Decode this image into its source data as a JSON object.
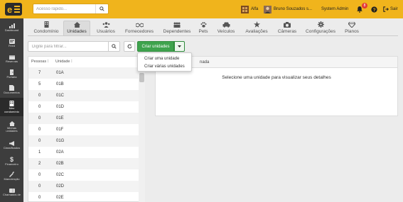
{
  "topbar": {
    "search_placeholder": "Acesso rápido...",
    "condo_name": "Alfa",
    "user_name": "Bruno Souzados s...",
    "role": "System Admin",
    "notifications_count": "8",
    "logout_label": "Sair"
  },
  "sidebar": {
    "items": [
      {
        "label": "Dashboard",
        "icon": "dashboard-icon"
      },
      {
        "label": "Feed",
        "icon": "feed-icon"
      },
      {
        "label": "Reservas",
        "icon": "calendar-icon"
      },
      {
        "label": "Portaria",
        "icon": "door-icon"
      },
      {
        "label": "Documentos",
        "icon": "document-icon"
      },
      {
        "label": "Meu condomínio",
        "icon": "building-icon"
      },
      {
        "label": "Minhas unidades",
        "icon": "home-icon"
      },
      {
        "label": "Classificados",
        "icon": "megaphone-icon"
      },
      {
        "label": "Financeiro",
        "icon": "dollar-icon"
      },
      {
        "label": "Manutenção",
        "icon": "wrench-icon"
      },
      {
        "label": "Chamados de",
        "icon": "ticket-icon"
      }
    ]
  },
  "tabs": [
    {
      "label": "Condomínio",
      "icon": "building-icon"
    },
    {
      "label": "Unidades",
      "icon": "home-icon"
    },
    {
      "label": "Usuários",
      "icon": "users-icon"
    },
    {
      "label": "Fornecedores",
      "icon": "handshake-icon"
    },
    {
      "label": "Dependentes",
      "icon": "group-icon"
    },
    {
      "label": "Pets",
      "icon": "paw-icon"
    },
    {
      "label": "Veículos",
      "icon": "car-icon"
    },
    {
      "label": "Avaliações",
      "icon": "star-icon"
    },
    {
      "label": "Câmeras",
      "icon": "camera-icon"
    },
    {
      "label": "Configurações",
      "icon": "gear-icon"
    },
    {
      "label": "Planos",
      "icon": "diamond-icon"
    }
  ],
  "active_tab": "Unidades",
  "toolbar": {
    "filter_placeholder": "Digite para filtrar...",
    "create_label": "Criar unidades"
  },
  "create_menu": {
    "items": [
      "Criar uma unidade",
      "Criar várias unidades"
    ]
  },
  "list": {
    "columns": [
      "Pessoas",
      "Unidade"
    ],
    "rows": [
      [
        "7",
        "01A"
      ],
      [
        "5",
        "01B"
      ],
      [
        "0",
        "01C"
      ],
      [
        "0",
        "01D"
      ],
      [
        "0",
        "01E"
      ],
      [
        "0",
        "01F"
      ],
      [
        "0",
        "01G"
      ],
      [
        "1",
        "02A"
      ],
      [
        "2",
        "02B"
      ],
      [
        "0",
        "02C"
      ],
      [
        "0",
        "02D"
      ],
      [
        "0",
        "02E"
      ]
    ]
  },
  "detail": {
    "header_fragment": "nada",
    "message": "Selecione uma unidade para visualizar seus detalhes"
  },
  "colors": {
    "topbar": "#f0b41c",
    "sidebar": "#3d3d3d",
    "primary_button": "#3fa34d",
    "badge": "#e53935"
  }
}
